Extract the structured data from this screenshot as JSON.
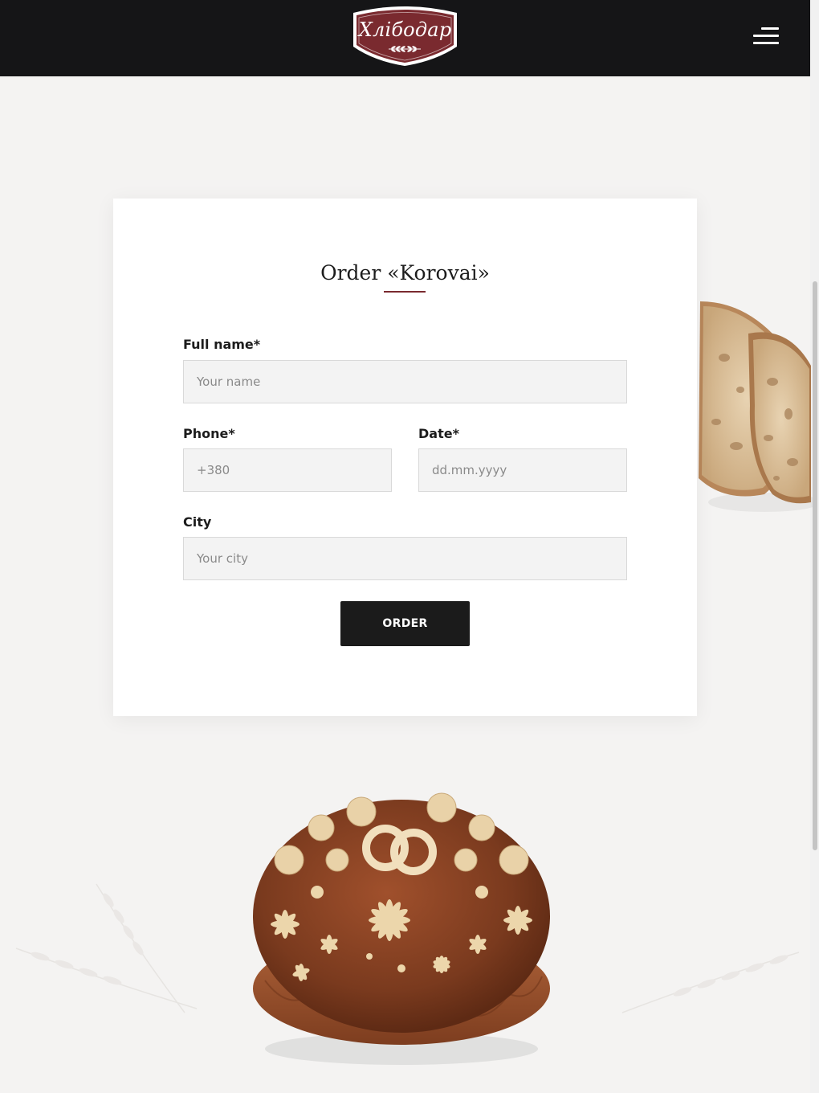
{
  "header": {
    "logo_text": "Хлібодар"
  },
  "form": {
    "title": "Order «Korovai»",
    "fields": {
      "full_name": {
        "label": "Full name*",
        "placeholder": "Your name",
        "value": ""
      },
      "phone": {
        "label": "Phone*",
        "placeholder": "+380",
        "value": ""
      },
      "date": {
        "label": "Date*",
        "placeholder": "dd.mm.yyyy",
        "value": ""
      },
      "city": {
        "label": "City",
        "placeholder": "Your city",
        "value": ""
      }
    },
    "submit_label": "ORDER"
  },
  "icons": {
    "menu": "hamburger-menu-icon",
    "logo_ornament": "wheat-ornament"
  },
  "colors": {
    "header_bg": "#151517",
    "brand_burgundy": "#7a2a2f",
    "page_bg": "#f4f3f2",
    "button_bg": "#1b1b1b"
  }
}
